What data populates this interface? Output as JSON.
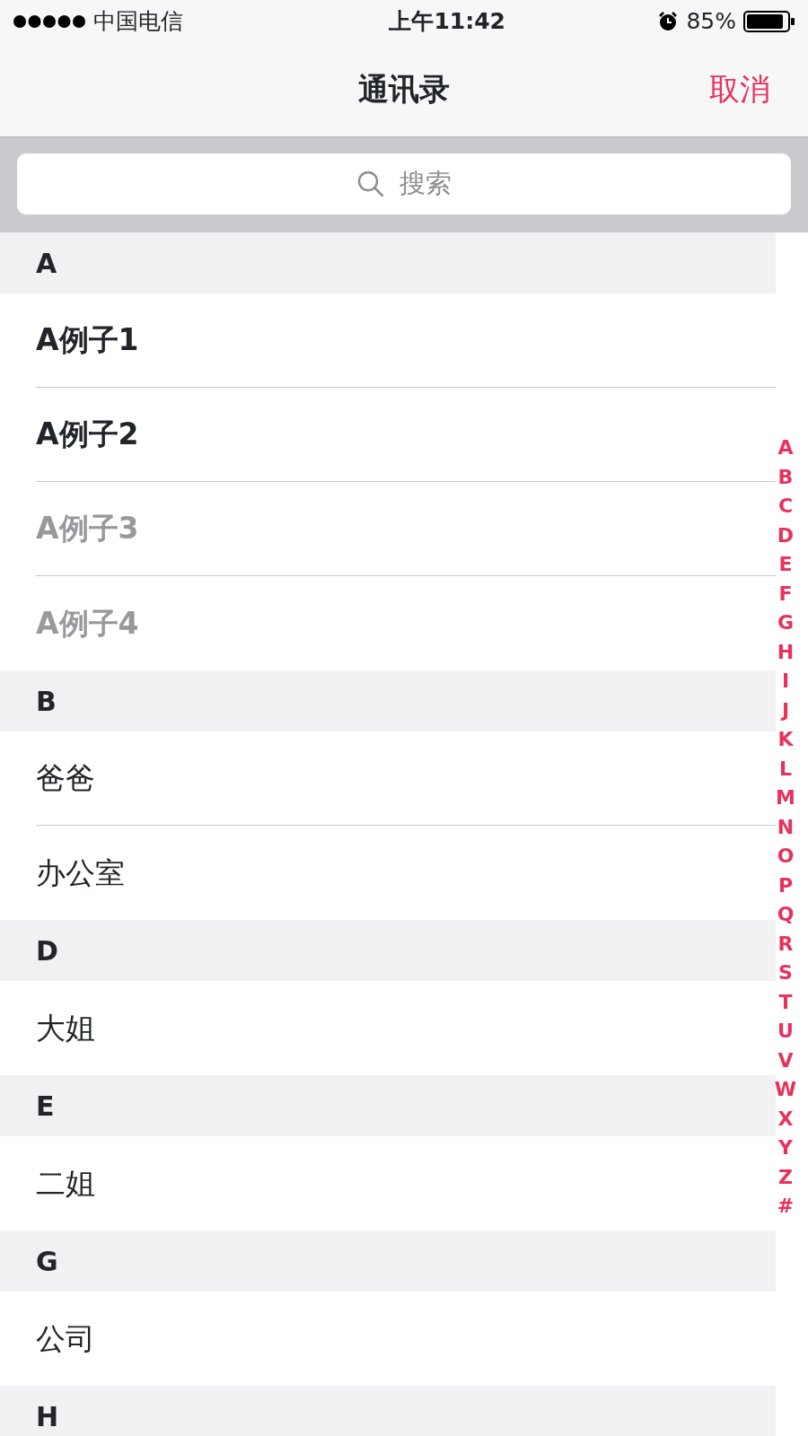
{
  "status_bar": {
    "carrier": "中国电信",
    "time": "上午11:42",
    "battery": "85%"
  },
  "nav": {
    "title": "通讯录",
    "cancel": "取消"
  },
  "search": {
    "placeholder": "搜索"
  },
  "sections": [
    {
      "letter": "A",
      "contacts": [
        {
          "name": "A例子1",
          "emphasized": true,
          "disabled": false
        },
        {
          "name": "A例子2",
          "emphasized": true,
          "disabled": false
        },
        {
          "name": "A例子3",
          "emphasized": true,
          "disabled": true
        },
        {
          "name": "A例子4",
          "emphasized": true,
          "disabled": true
        }
      ]
    },
    {
      "letter": "B",
      "contacts": [
        {
          "name": "爸爸",
          "emphasized": false,
          "disabled": false
        },
        {
          "name": "办公室",
          "emphasized": false,
          "disabled": false
        }
      ]
    },
    {
      "letter": "D",
      "contacts": [
        {
          "name": "大姐",
          "emphasized": false,
          "disabled": false
        }
      ]
    },
    {
      "letter": "E",
      "contacts": [
        {
          "name": "二姐",
          "emphasized": false,
          "disabled": false
        }
      ]
    },
    {
      "letter": "G",
      "contacts": [
        {
          "name": "公司",
          "emphasized": false,
          "disabled": false
        }
      ]
    },
    {
      "letter": "H"
    }
  ],
  "index": [
    "A",
    "B",
    "C",
    "D",
    "E",
    "F",
    "G",
    "H",
    "I",
    "J",
    "K",
    "L",
    "M",
    "N",
    "O",
    "P",
    "Q",
    "R",
    "S",
    "T",
    "U",
    "V",
    "W",
    "X",
    "Y",
    "Z",
    "#"
  ]
}
